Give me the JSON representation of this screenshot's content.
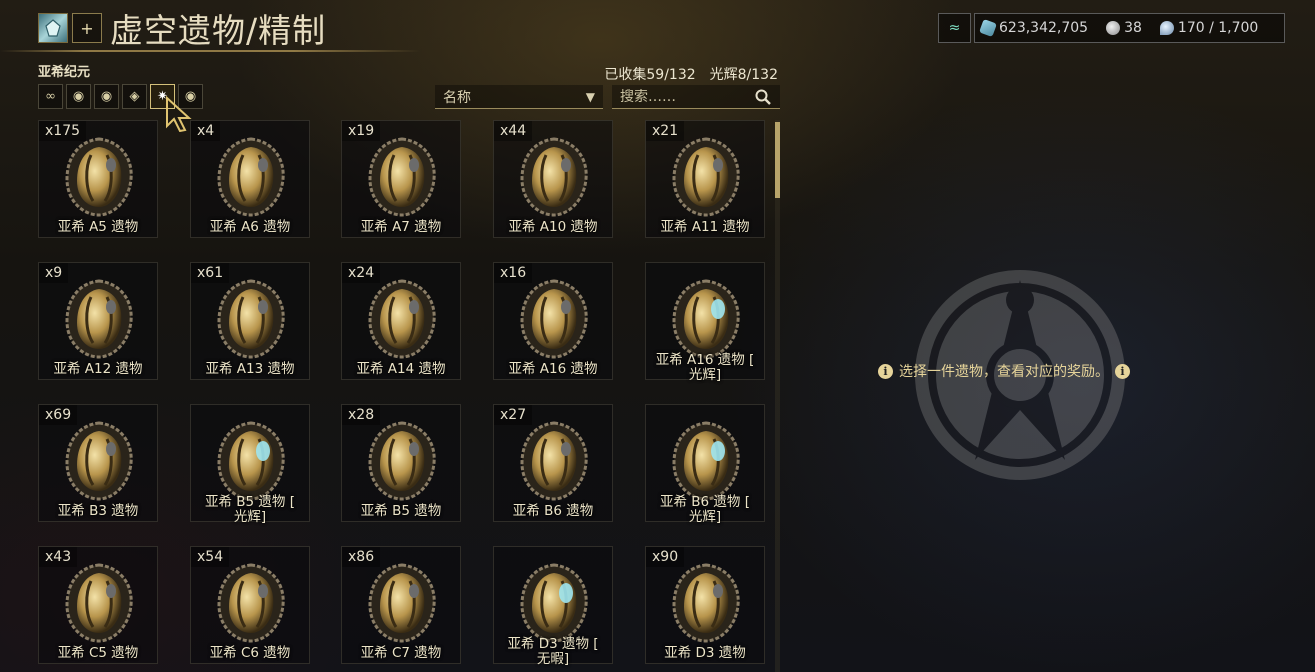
{
  "header": {
    "title": "虚空遗物/精制",
    "plus_label": "+",
    "era": "亚希纪元"
  },
  "currency": {
    "credits": "623,342,705",
    "platinum": "38",
    "slots": "170 / 1,700"
  },
  "stats": {
    "collected": "已收集59/132",
    "radiant": "光辉8/132"
  },
  "filters": [
    {
      "icon": "infinity-icon",
      "glyph": "∞",
      "active": false
    },
    {
      "icon": "lith-icon",
      "glyph": "◉",
      "active": false
    },
    {
      "icon": "meso-icon",
      "glyph": "◉",
      "active": false
    },
    {
      "icon": "neo-icon",
      "glyph": "◈",
      "active": false
    },
    {
      "icon": "axi-icon",
      "glyph": "✷",
      "active": true
    },
    {
      "icon": "requiem-icon",
      "glyph": "◉",
      "active": false
    }
  ],
  "sort": {
    "label": "名称"
  },
  "search": {
    "placeholder": "搜索……"
  },
  "relics": [
    {
      "count": "x175",
      "name": "亚希 A5 遗物",
      "radiant": false
    },
    {
      "count": "x4",
      "name": "亚希 A6 遗物",
      "radiant": false
    },
    {
      "count": "x19",
      "name": "亚希 A7 遗物",
      "radiant": false
    },
    {
      "count": "x44",
      "name": "亚希 A10 遗物",
      "radiant": false
    },
    {
      "count": "x21",
      "name": "亚希 A11 遗物",
      "radiant": false
    },
    {
      "count": "x9",
      "name": "亚希 A12 遗物",
      "radiant": false
    },
    {
      "count": "x61",
      "name": "亚希 A13 遗物",
      "radiant": false
    },
    {
      "count": "x24",
      "name": "亚希 A14 遗物",
      "radiant": false
    },
    {
      "count": "x16",
      "name": "亚希 A16 遗物",
      "radiant": false
    },
    {
      "count": "",
      "name": "亚希 A16 遗物 [\n光辉]",
      "radiant": true
    },
    {
      "count": "x69",
      "name": "亚希 B3 遗物",
      "radiant": false
    },
    {
      "count": "",
      "name": "亚希 B5 遗物 [\n光辉]",
      "radiant": true
    },
    {
      "count": "x28",
      "name": "亚希 B5 遗物",
      "radiant": false
    },
    {
      "count": "x27",
      "name": "亚希 B6 遗物",
      "radiant": false
    },
    {
      "count": "",
      "name": "亚希 B6 遗物 [\n光辉]",
      "radiant": true
    },
    {
      "count": "x43",
      "name": "亚希 C5 遗物",
      "radiant": false
    },
    {
      "count": "x54",
      "name": "亚希 C6 遗物",
      "radiant": false
    },
    {
      "count": "x86",
      "name": "亚希 C7 遗物",
      "radiant": false
    },
    {
      "count": "",
      "name": "亚希 D3 遗物 [\n无暇]",
      "radiant": true
    },
    {
      "count": "x90",
      "name": "亚希 D3 遗物",
      "radiant": false
    }
  ],
  "hint": "选择一件遗物，查看对应的奖励。",
  "colors": {
    "accent": "#d4c07a",
    "text": "#ece4c8",
    "radiant_glow": "#9fe6f0"
  }
}
